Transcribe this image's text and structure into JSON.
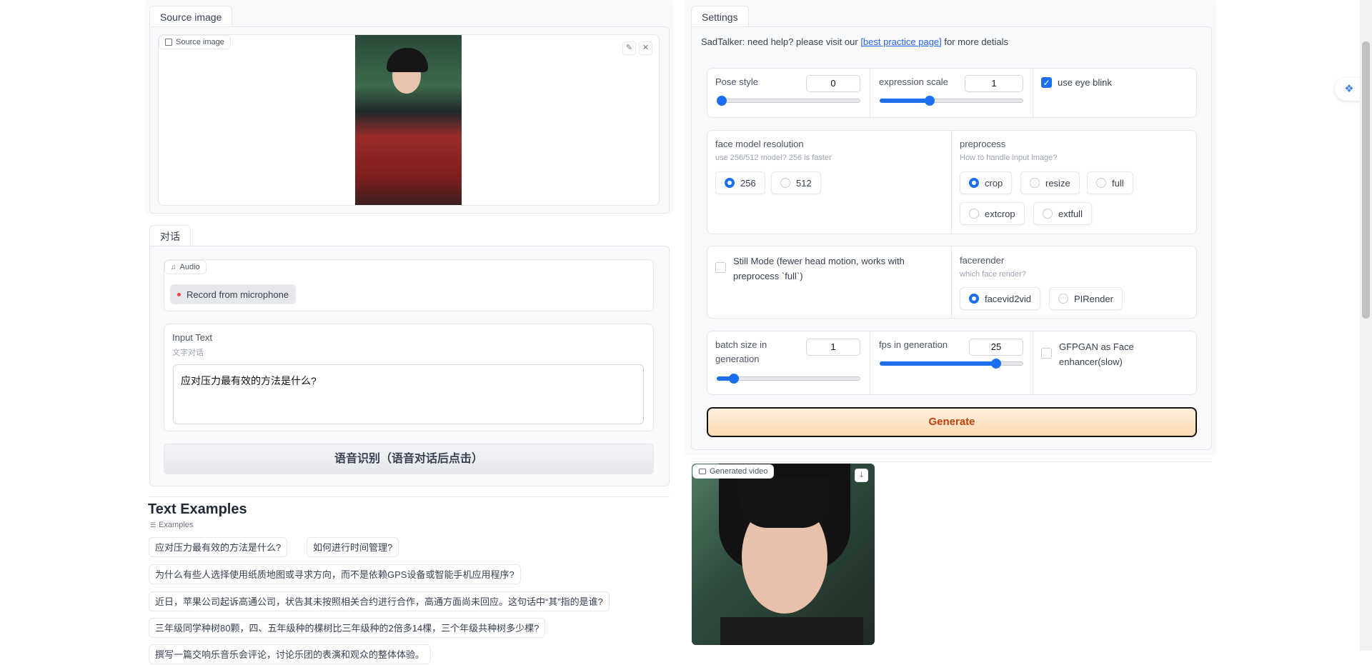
{
  "left": {
    "source_tab": "Source image",
    "source_label": "Source image",
    "dialog_tab": "对话",
    "audio_label": "Audio",
    "record_button": "Record from microphone",
    "input_text_label": "Input Text",
    "input_text_info": "文字对话",
    "input_text_value": "应对压力最有效的方法是什么?",
    "asr_button": "语音识别（语音对话后点击）",
    "examples_heading": "Text Examples",
    "examples_label": "Examples",
    "examples": [
      "应对压力最有效的方法是什么?",
      "如何进行时间管理?",
      "为什么有些人选择使用纸质地图或寻求方向，而不是依赖GPS设备或智能手机应用程序?",
      "近日，苹果公司起诉高通公司，状告其未按照相关合约进行合作，高通方面尚未回应。这句话中“其”指的是谁?",
      "三年级同学种树80颗，四、五年级种的棵树比三年级种的2倍多14棵，三个年级共种树多少棵?",
      "撰写一篇交响乐音乐会评论，讨论乐团的表演和观众的整体体验。"
    ]
  },
  "right": {
    "settings_tab": "Settings",
    "help_prefix": "SadTalker: need help? please visit our ",
    "help_link": "[best practice page]",
    "help_suffix": " for more detials",
    "pose_style_label": "Pose style",
    "pose_style_value": "0",
    "pose_style_fraction": 0.0,
    "expression_label": "expression scale",
    "expression_value": "1",
    "expression_fraction": 0.34,
    "eye_blink_label": "use eye blink",
    "eye_blink_checked": true,
    "face_res_label": "face model resolution",
    "face_res_info": "use 256/512 model? 256 is faster",
    "face_res_options": [
      "256",
      "512"
    ],
    "preprocess_label": "preprocess",
    "preprocess_info": "How to handle input image?",
    "preprocess_options": [
      "crop",
      "resize",
      "full",
      "extcrop",
      "extfull"
    ],
    "still_mode_label": "Still Mode (fewer head motion, works with preprocess `full`)",
    "facerender_label": "facerender",
    "facerender_info": "which face render?",
    "facerender_options": [
      "facevid2vid",
      "PIRender"
    ],
    "batch_label": "batch size in generation",
    "batch_value": "1",
    "batch_fraction": 0.1,
    "fps_label": "fps in generation",
    "fps_value": "25",
    "fps_fraction": 0.81,
    "gfpgan_label": "GFPGAN as Face enhancer(slow)",
    "generate_button": "Generate",
    "video_label": "Generated video"
  },
  "colors": {
    "accent": "#1d6ff2",
    "generate_bg": "#fde4c8",
    "generate_text": "#c2410c",
    "link": "#2563eb"
  }
}
